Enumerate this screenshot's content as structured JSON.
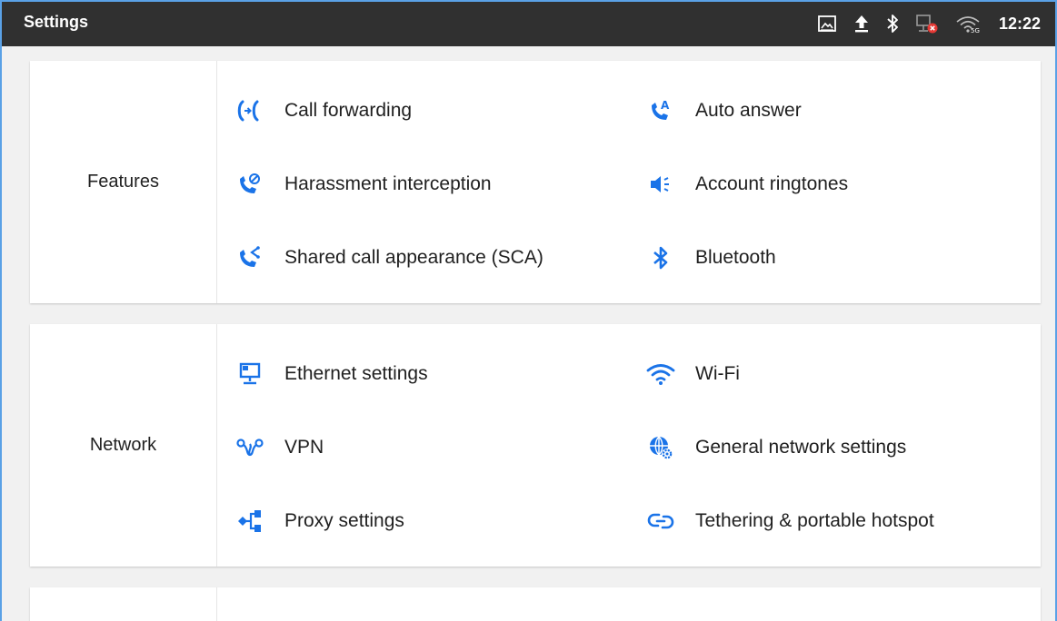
{
  "statusbar": {
    "title": "Settings",
    "clock": "12:22",
    "icons": [
      "gallery-icon",
      "upload-icon",
      "bluetooth-icon",
      "ethernet-error-icon",
      "wifi-5g-icon"
    ],
    "wifi_band": "5G"
  },
  "accent": "#1a73e8",
  "sections": [
    {
      "label": "Features",
      "items": [
        {
          "label": "Call forwarding",
          "icon": "call-forwarding-icon"
        },
        {
          "label": "Auto answer",
          "icon": "auto-answer-icon",
          "badge": "A"
        },
        {
          "label": "Harassment interception",
          "icon": "harassment-interception-icon"
        },
        {
          "label": "Account ringtones",
          "icon": "ringtone-icon"
        },
        {
          "label": "Shared call appearance (SCA)",
          "icon": "shared-call-icon"
        },
        {
          "label": "Bluetooth",
          "icon": "bluetooth-icon"
        }
      ]
    },
    {
      "label": "Network",
      "items": [
        {
          "label": "Ethernet settings",
          "icon": "ethernet-icon"
        },
        {
          "label": "Wi-Fi",
          "icon": "wifi-icon"
        },
        {
          "label": "VPN",
          "icon": "vpn-icon"
        },
        {
          "label": "General network settings",
          "icon": "network-settings-icon"
        },
        {
          "label": "Proxy settings",
          "icon": "proxy-icon"
        },
        {
          "label": "Tethering & portable hotspot",
          "icon": "hotspot-icon"
        }
      ]
    }
  ]
}
